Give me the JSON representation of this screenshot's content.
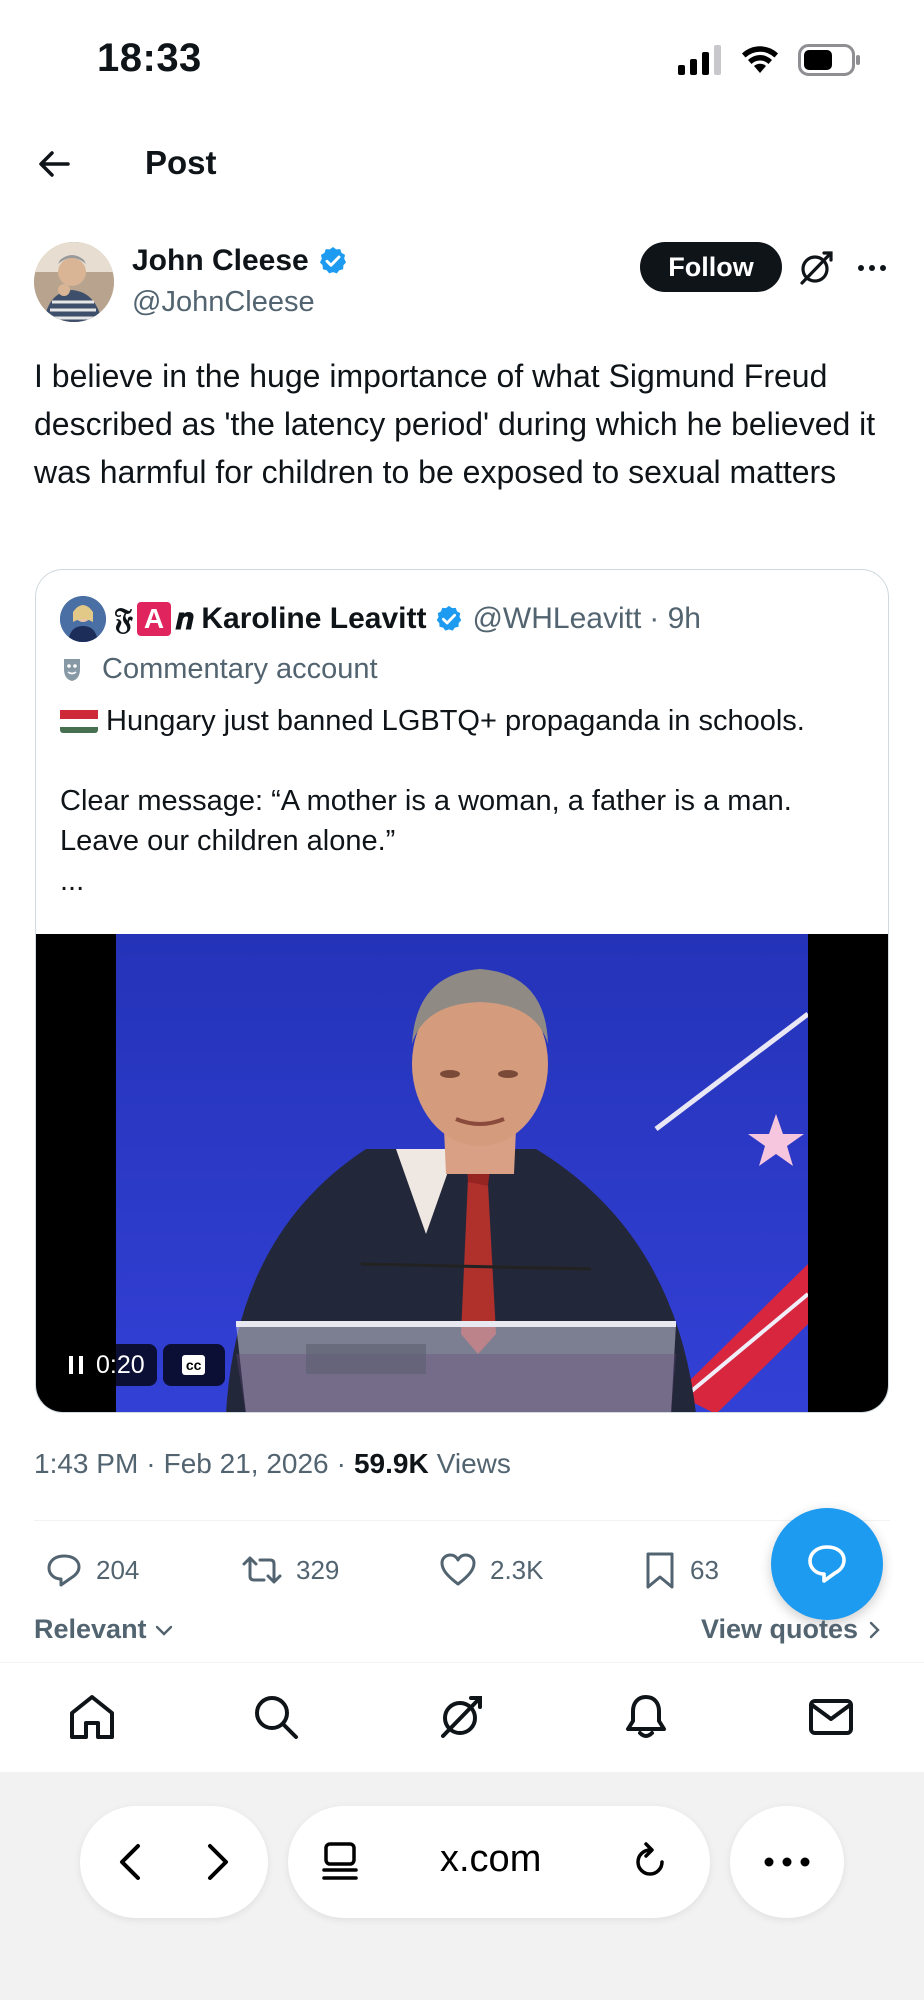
{
  "status": {
    "time": "18:33"
  },
  "header": {
    "title": "Post"
  },
  "author": {
    "name": "John Cleese",
    "handle": "@JohnCleese",
    "follow_label": "Follow"
  },
  "post": {
    "text": "I believe in the huge importance of what Sigmund Freud described as 'the latency period' during which he believed it was harmful for children to be exposed to sexual matters"
  },
  "quote": {
    "name_prefix": "𝔉",
    "name_prefix_mid": "A",
    "name_prefix_end": "𝒏",
    "name": "Karoline Leavitt",
    "handle": "@WHLeavitt",
    "time": "· 9h",
    "commentary_label": "Commentary account",
    "body_line1": "Hungary just banned LGBTQ+ propaganda in schools.",
    "body_line2": "Clear message: “A mother is a woman, a father is a man. Leave our children alone.”",
    "ellipsis": "...",
    "video": {
      "elapsed": "0:20",
      "cc_label": "cc"
    }
  },
  "meta": {
    "time": "1:43 PM",
    "date": "Feb 21, 2026",
    "sep": "·",
    "views_count": "59.9K",
    "views_label": "Views"
  },
  "actions": {
    "replies": "204",
    "reposts": "329",
    "likes": "2.3K",
    "bookmarks": "63"
  },
  "filter": {
    "sort_label": "Relevant",
    "view_quotes_label": "View quotes"
  },
  "browser": {
    "url": "x.com"
  },
  "colors": {
    "accent": "#1d9bf0",
    "verified": "#1d9bf0",
    "text": "#0f1419",
    "muted": "#536471"
  }
}
